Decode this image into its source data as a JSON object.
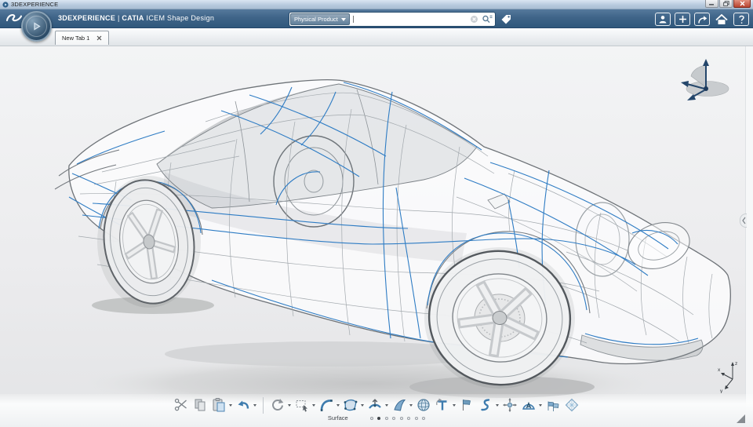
{
  "window": {
    "title": "3DEXPERIENCE"
  },
  "header": {
    "brand": "3DEXPERIENCE",
    "divider": "|",
    "app_name": "CATIA",
    "app_suffix": "ICEM Shape Design",
    "search": {
      "scope": "Physical Product",
      "value": ""
    },
    "nav_icons": [
      "user",
      "add",
      "share",
      "home",
      "help"
    ],
    "colors": {
      "bar_blue": "#3f6488",
      "accent_blue": "#2e7cc4"
    }
  },
  "tabstrip": {
    "tabs": [
      {
        "label": "New Tab 1",
        "active": true,
        "closable": true
      }
    ]
  },
  "viewport": {
    "axis_labels": {
      "x": "x",
      "y": "y",
      "z": "z"
    },
    "widgets": [
      "view-compass",
      "axis-triad",
      "panel-handle",
      "resize-grip"
    ]
  },
  "action_bar": {
    "section_label": "Surface",
    "pages": {
      "count": 8,
      "active_index": 1
    },
    "tools": [
      {
        "name": "cut",
        "dropdown": false
      },
      {
        "name": "copy",
        "dropdown": false
      },
      {
        "name": "paste",
        "dropdown": true
      },
      {
        "name": "undo",
        "dropdown": true
      },
      {
        "name": "separator",
        "dropdown": false
      },
      {
        "name": "update",
        "dropdown": true
      },
      {
        "name": "frame-selection",
        "dropdown": true
      },
      {
        "name": "create-curve",
        "dropdown": true
      },
      {
        "name": "create-patch",
        "dropdown": true
      },
      {
        "name": "modify-surface",
        "dropdown": true
      },
      {
        "name": "blend-surface",
        "dropdown": true
      },
      {
        "name": "sphere",
        "dropdown": false
      },
      {
        "name": "twist",
        "dropdown": true
      },
      {
        "name": "flag-analysis",
        "dropdown": false
      },
      {
        "name": "match-curve",
        "dropdown": true
      },
      {
        "name": "transform",
        "dropdown": false
      },
      {
        "name": "surface-analysis",
        "dropdown": true
      },
      {
        "name": "curvature-combs",
        "dropdown": false
      },
      {
        "name": "net-surface",
        "dropdown": false
      }
    ]
  }
}
